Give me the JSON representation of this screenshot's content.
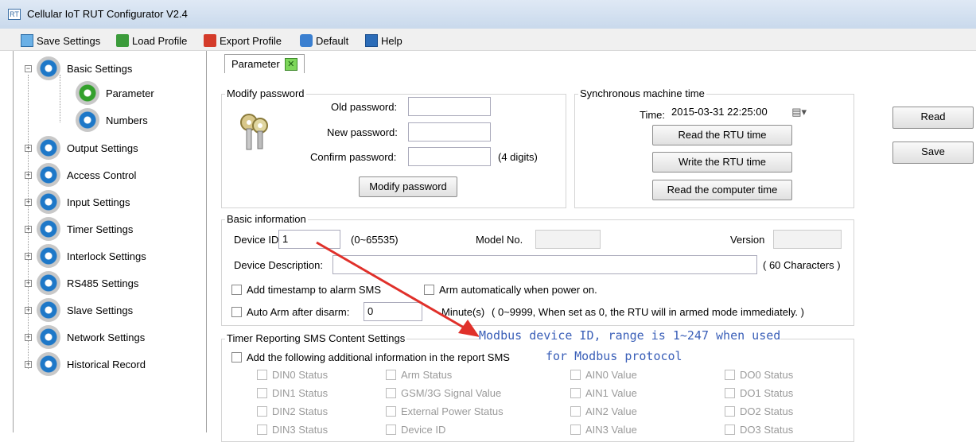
{
  "window": {
    "title": "Cellular IoT RUT Configurator V2.4"
  },
  "menubar": [
    {
      "label": "Save Settings",
      "icon": "save-icon"
    },
    {
      "label": "Load Profile",
      "icon": "load-icon"
    },
    {
      "label": "Export Profile",
      "icon": "export-icon"
    },
    {
      "label": "Default",
      "icon": "default-icon"
    },
    {
      "label": "Help",
      "icon": "help-icon"
    }
  ],
  "tree": [
    {
      "label": "Basic Settings",
      "expander": "−"
    },
    {
      "label": "Parameter"
    },
    {
      "label": "Numbers"
    },
    {
      "label": "Output Settings",
      "expander": "+"
    },
    {
      "label": "Access Control",
      "expander": "+"
    },
    {
      "label": "Input Settings",
      "expander": "+"
    },
    {
      "label": "Timer Settings",
      "expander": "+"
    },
    {
      "label": "Interlock Settings",
      "expander": "+"
    },
    {
      "label": "RS485 Settings",
      "expander": "+"
    },
    {
      "label": "Slave Settings",
      "expander": "+"
    },
    {
      "label": "Network Settings",
      "expander": "+"
    },
    {
      "label": "Historical Record",
      "expander": "+"
    }
  ],
  "tab": {
    "label": "Parameter",
    "close_glyph": "✕"
  },
  "modify_password": {
    "title": "Modify password",
    "old_label": "Old password:",
    "new_label": "New password:",
    "confirm_label": "Confirm password:",
    "hint": "(4 digits)",
    "button": "Modify password"
  },
  "sync_time": {
    "title": "Synchronous machine time",
    "time_label": "Time:",
    "time_value": "2015-03-31 22:25:00",
    "read_rtu": "Read the RTU time",
    "write_rtu": "Write the RTU time",
    "read_computer": "Read the computer time"
  },
  "side_buttons": {
    "read": "Read",
    "save": "Save"
  },
  "basic_info": {
    "title": "Basic information",
    "device_id_label": "Device ID",
    "device_id_value": "1",
    "device_id_range": "(0~65535)",
    "model_label": "Model No.",
    "version_label": "Version",
    "desc_label": "Device Description:",
    "desc_hint": "( 60 Characters )",
    "timestamp_label": "Add timestamp to alarm SMS",
    "auto_arm_power_label": "Arm automatically when power on.",
    "auto_arm_disarm_label": "Auto Arm after disarm:",
    "auto_arm_value": "0",
    "minute_label": "Minute(s)",
    "minute_hint": "( 0~9999, When set as 0, the RTU will in armed mode immediately. )"
  },
  "timer_sms": {
    "title": "Timer Reporting SMS Content Settings",
    "add_info_label": "Add the following additional information in the report SMS",
    "col1": [
      "DIN0 Status",
      "DIN1 Status",
      "DIN2 Status",
      "DIN3 Status"
    ],
    "col2": [
      "Arm Status",
      "GSM/3G Signal Value",
      "External Power Status",
      "Device ID"
    ],
    "col3": [
      "AIN0 Value",
      "AIN1 Value",
      "AIN2 Value",
      "AIN3 Value"
    ],
    "col4": [
      "DO0 Status",
      "DO1 Status",
      "DO2 Status",
      "DO3 Status"
    ]
  },
  "annotation": {
    "line1": "Modbus device ID, range is 1~247 when used",
    "line2": "for Modbus protocol",
    "color": "#3a5fb8",
    "arrow_color": "#e0302a"
  }
}
